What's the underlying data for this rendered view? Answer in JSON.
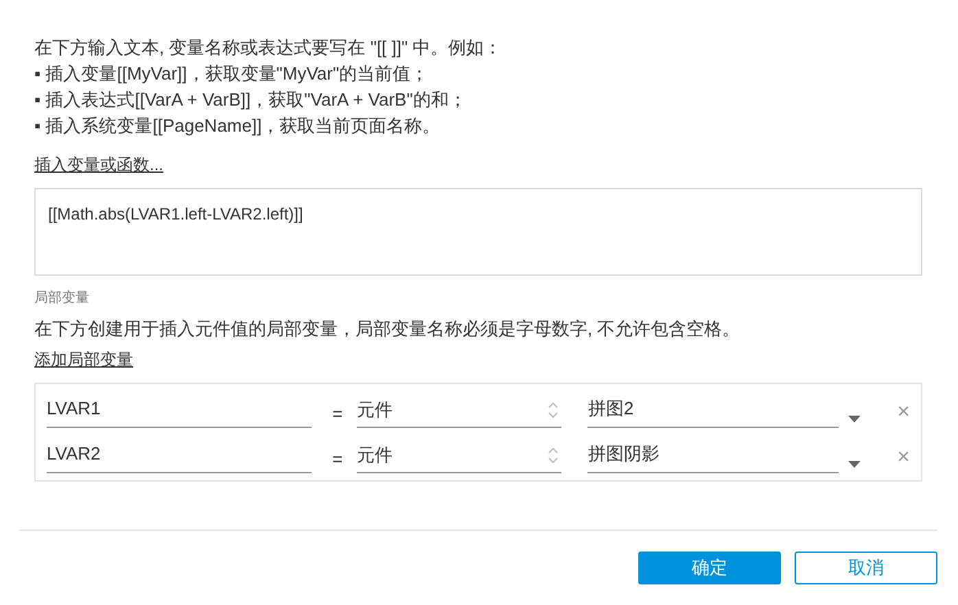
{
  "intro": "在下方输入文本, 变量名称或表达式要写在 \"[[ ]]\" 中。例如：",
  "examples": [
    "▪ 插入变量[[MyVar]]，获取变量\"MyVar\"的当前值；",
    "▪ 插入表达式[[VarA + VarB]]，获取\"VarA + VarB\"的和；",
    "▪ 插入系统变量[[PageName]]，获取当前页面名称。"
  ],
  "insert_link": "插入变量或函数...",
  "expression": "[[Math.abs(LVAR1.left-LVAR2.left)]]",
  "local_vars": {
    "heading": "局部变量",
    "description": "在下方创建用于插入元件值的局部变量，局部变量名称必须是字母数字, 不允许包含空格。",
    "add_link": "添加局部变量",
    "rows": [
      {
        "name": "LVAR1",
        "equals": "=",
        "type": "元件",
        "target": "拼图2",
        "remove": "×"
      },
      {
        "name": "LVAR2",
        "equals": "=",
        "type": "元件",
        "target": "拼图阴影",
        "remove": "×"
      }
    ]
  },
  "buttons": [
    {
      "label": "确定",
      "kind": "primary"
    },
    {
      "label": "取消",
      "kind": "secondary"
    }
  ]
}
